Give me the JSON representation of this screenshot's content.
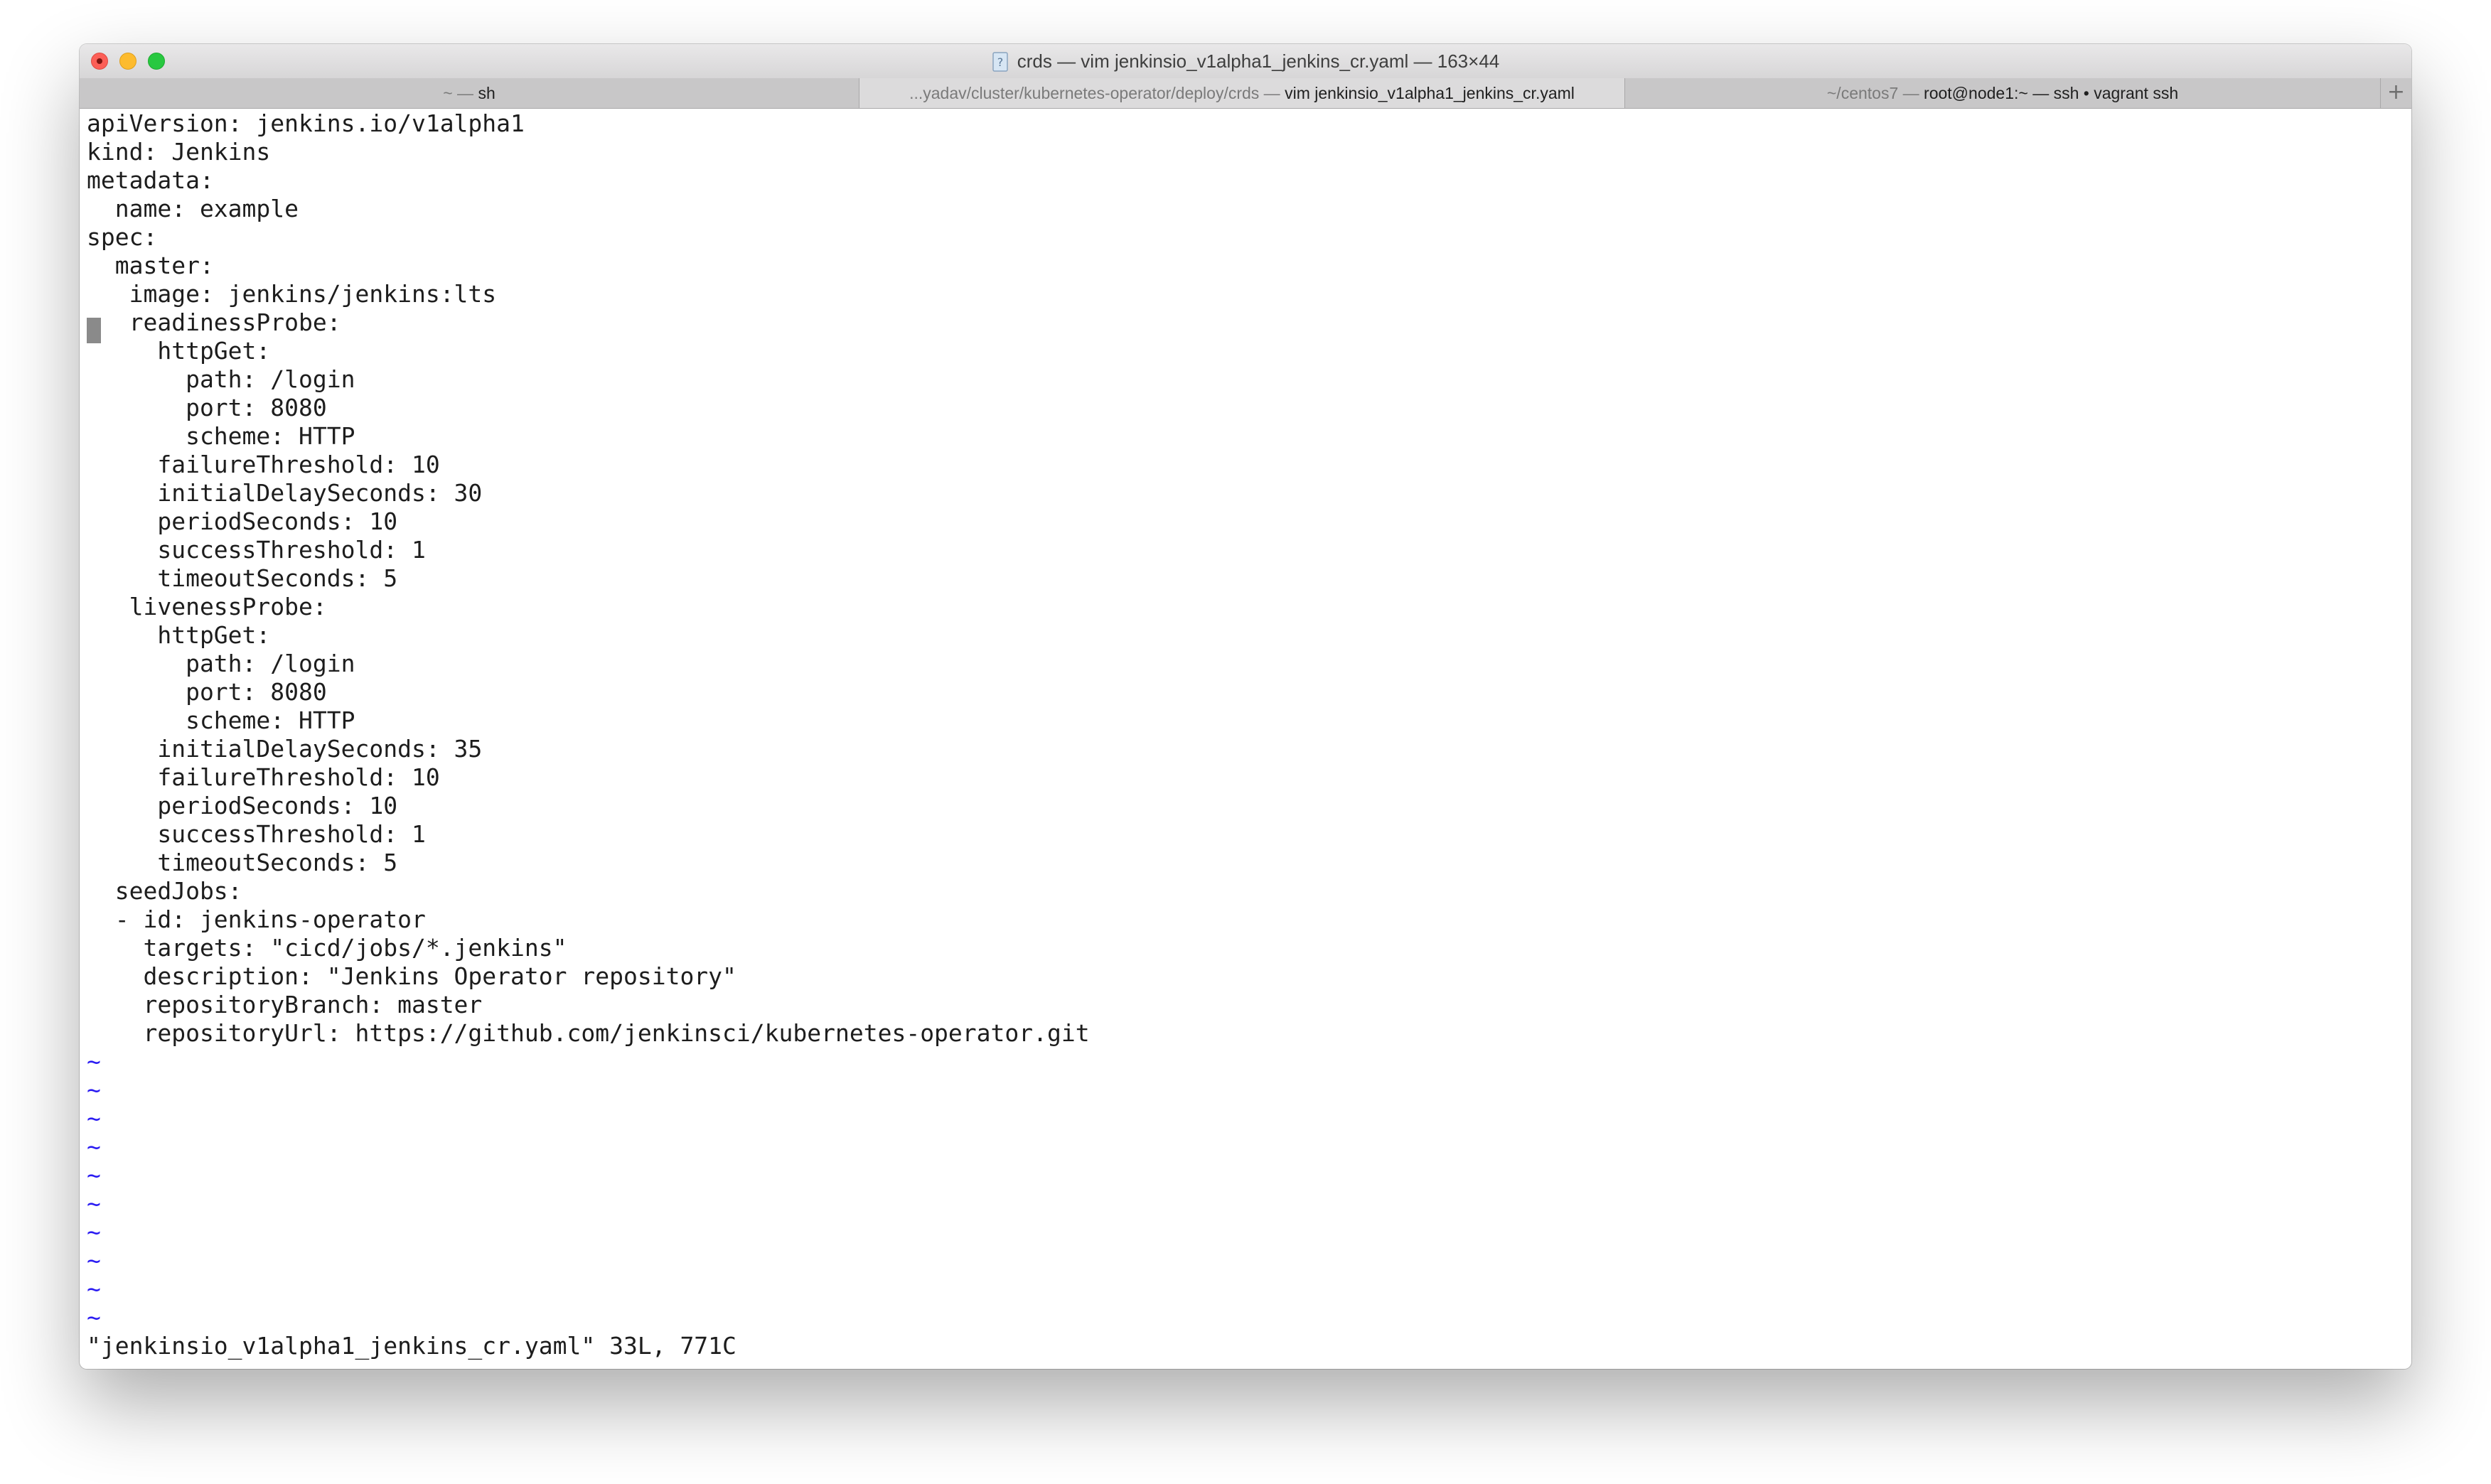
{
  "window": {
    "title": "crds — vim jenkinsio_v1alpha1_jenkins_cr.yaml — 163×44"
  },
  "tabs": [
    {
      "dim": "~ — ",
      "label": "sh"
    },
    {
      "dim": "...yadav/cluster/kubernetes-operator/deploy/crds — ",
      "label": "vim jenkinsio_v1alpha1_jenkins_cr.yaml"
    },
    {
      "dim": "~/centos7 — ",
      "label": "root@node1:~ — ssh • vagrant ssh"
    }
  ],
  "tab_add_label": "+",
  "editor": {
    "lines": [
      "apiVersion: jenkins.io/v1alpha1",
      "kind: Jenkins",
      "metadata:",
      "  name: example",
      "spec:",
      "  master:",
      "   image: jenkins/jenkins:lts",
      "   readinessProbe:",
      "     httpGet:",
      "       path: /login",
      "       port: 8080",
      "       scheme: HTTP",
      "     failureThreshold: 10",
      "     initialDelaySeconds: 30",
      "     periodSeconds: 10",
      "     successThreshold: 1",
      "     timeoutSeconds: 5",
      "   livenessProbe:",
      "     httpGet:",
      "       path: /login",
      "       port: 8080",
      "       scheme: HTTP",
      "     initialDelaySeconds: 35",
      "     failureThreshold: 10",
      "     periodSeconds: 10",
      "     successThreshold: 1",
      "     timeoutSeconds: 5",
      "  seedJobs:",
      "  - id: jenkins-operator",
      "    targets: \"cicd/jobs/*.jenkins\"",
      "    description: \"Jenkins Operator repository\"",
      "    repositoryBranch: master",
      "    repositoryUrl: https://github.com/jenkinsci/kubernetes-operator.git"
    ],
    "tildes": [
      "~",
      "~",
      "~",
      "~",
      "~",
      "~",
      "~",
      "~",
      "~",
      "~"
    ],
    "status_line": "\"jenkinsio_v1alpha1_jenkins_cr.yaml\" 33L, 771C"
  }
}
